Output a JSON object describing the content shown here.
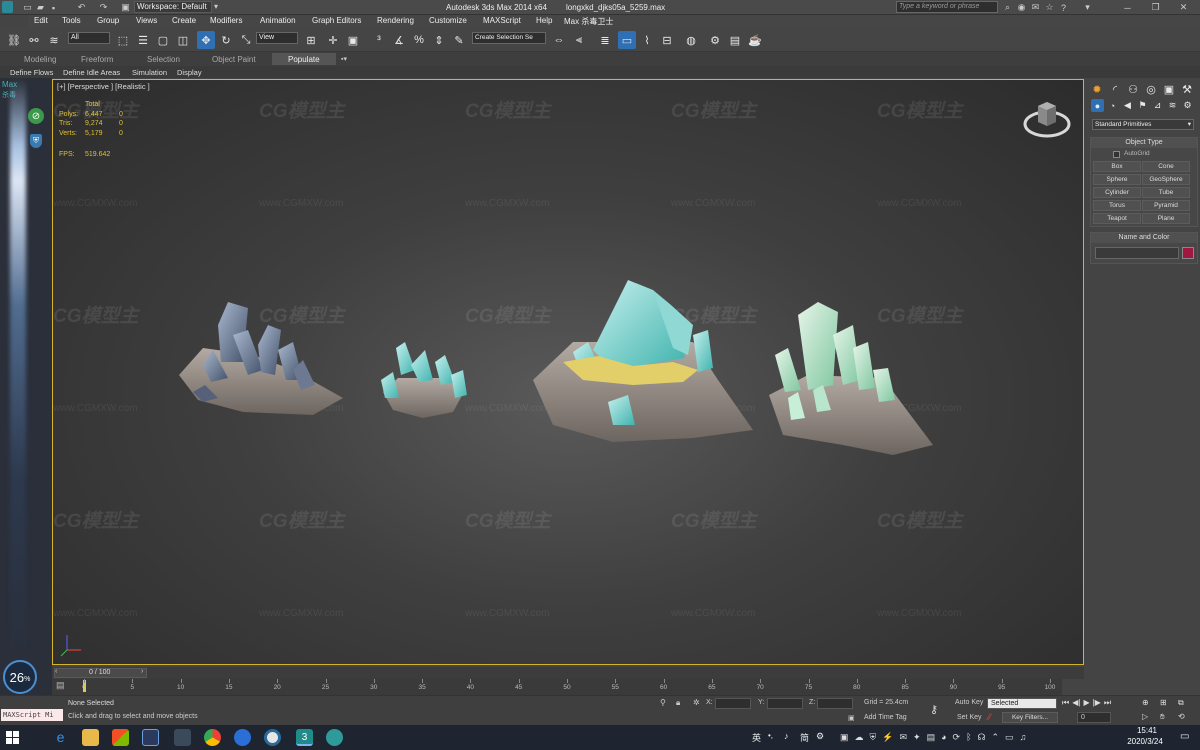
{
  "title_bar": {
    "workspace_label": "Workspace: Default",
    "app_title": "Autodesk 3ds Max  2014 x64",
    "file_name": "longxkd_djks05a_5259.max",
    "search_placeholder": "Type a keyword or phrase"
  },
  "menu": {
    "items": [
      "Edit",
      "Tools",
      "Group",
      "Views",
      "Create",
      "Modifiers",
      "Animation",
      "Graph Editors",
      "Rendering",
      "Customize",
      "MAXScript",
      "Help",
      "Max 杀毒卫士"
    ]
  },
  "toolbar": {
    "selection_filter": "All",
    "reference_coord": "View",
    "named_selection": "Create Selection Se"
  },
  "ribbon": {
    "tabs": [
      "Modeling",
      "Freeform",
      "Selection",
      "Object Paint",
      "Populate"
    ],
    "sub_items": [
      "Define Flows",
      "Define Idle Areas",
      "Simulation",
      "Display"
    ]
  },
  "left_strip": {
    "logo": "Max",
    "logo_sub": "杀毒"
  },
  "viewport": {
    "label": "[+] [Perspective ] [Realistic ]",
    "stats": {
      "total_label": "Total",
      "polys_label": "Polys:",
      "polys_value": "6,447",
      "polys_sel": "0",
      "tris_label": "Tris:",
      "tris_value": "9,274",
      "tris_sel": "0",
      "verts_label": "Verts:",
      "verts_value": "5,179",
      "verts_sel": "0",
      "fps_label": "FPS:",
      "fps_value": "519.642"
    },
    "watermark": "CG模型主",
    "watermark_url": "www.CGMXW.com"
  },
  "command_panel": {
    "dropdown": "Standard Primitives",
    "object_type_header": "Object Type",
    "autogrid": "AutoGrid",
    "primitives": [
      "Box",
      "Cone",
      "Sphere",
      "GeoSphere",
      "Cylinder",
      "Tube",
      "Torus",
      "Pyramid",
      "Teapot",
      "Plane"
    ],
    "name_color_header": "Name and Color",
    "object_color": "#a01840"
  },
  "timeline": {
    "slider_label": "0 / 100",
    "ticks": [
      "0",
      "5",
      "10",
      "15",
      "20",
      "25",
      "30",
      "35",
      "40",
      "45",
      "50",
      "55",
      "60",
      "65",
      "70",
      "75",
      "80",
      "85",
      "90",
      "95",
      "100"
    ]
  },
  "status": {
    "selection": "None Selected",
    "prompt": "Click and drag to select and move objects",
    "maxscript": "MAXScript Mi",
    "x_label": "X:",
    "y_label": "Y:",
    "z_label": "Z:",
    "grid": "Grid = 25.4cm",
    "add_time_tag": "Add Time Tag",
    "auto_key": "Auto Key",
    "set_key": "Set Key",
    "key_mode": "Selected",
    "key_filters": "Key Filters...",
    "frame": "0"
  },
  "taskbar": {
    "time": "15:41",
    "date": "2020/3/24",
    "ime_lang": "英",
    "ime_mode": "简",
    "perf_value": "26",
    "perf_unit": "%"
  }
}
